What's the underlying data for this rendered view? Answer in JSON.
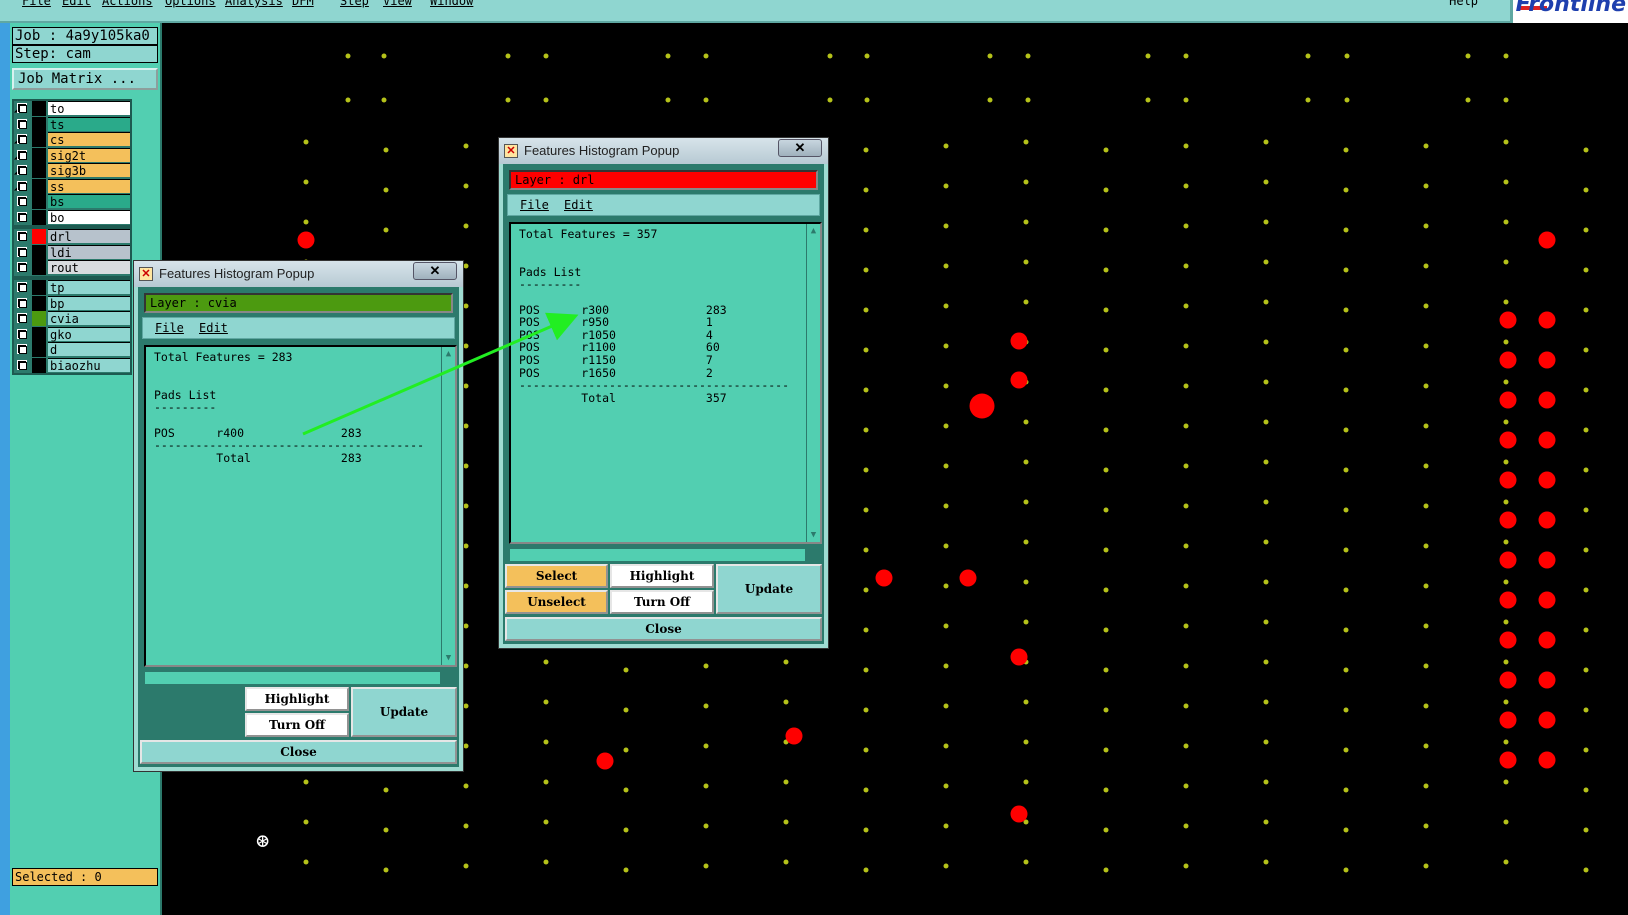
{
  "menubar": {
    "items": [
      "File",
      "Edit",
      "Actions",
      "Options",
      "Analysis",
      "DFM",
      "Step",
      "View",
      "Window"
    ],
    "help": "Help",
    "logo": "Frontline"
  },
  "job": {
    "job_label": "Job : 4a9y105ka0",
    "step_label": "Step: cam",
    "job_matrix_button": "Job Matrix ..."
  },
  "layers": {
    "group1": [
      {
        "name": "to",
        "color": "#ffffff",
        "swatch": "#000000",
        "arrow": true
      },
      {
        "name": "ts",
        "color": "#2aaa8a",
        "swatch": "#000000",
        "arrow": false
      },
      {
        "name": "cs",
        "color": "#f4c05b",
        "swatch": "#000000",
        "arrow": true
      },
      {
        "name": "sig2t",
        "color": "#f4c05b",
        "swatch": "#000000",
        "arrow": true
      },
      {
        "name": "sig3b",
        "color": "#f4c05b",
        "swatch": "#000000",
        "arrow": true
      },
      {
        "name": "ss",
        "color": "#f4c05b",
        "swatch": "#000000",
        "arrow": true
      },
      {
        "name": "bs",
        "color": "#2aaa8a",
        "swatch": "#000000",
        "arrow": false
      },
      {
        "name": "bo",
        "color": "#ffffff",
        "swatch": "#000000",
        "arrow": false
      }
    ],
    "group2": [
      {
        "name": "drl",
        "color": "#b7c2cc",
        "swatch": "#ff0000",
        "arrow": false
      },
      {
        "name": "ldi",
        "color": "#b7c2cc",
        "swatch": "#000000",
        "arrow": false
      },
      {
        "name": "rout",
        "color": "#d8dcdf",
        "swatch": "#000000",
        "arrow": false
      }
    ],
    "group3": [
      {
        "name": "tp",
        "color": "#8fd6d0",
        "swatch": "#000000",
        "arrow": false
      },
      {
        "name": "bp",
        "color": "#8fd6d0",
        "swatch": "#000000",
        "arrow": false
      },
      {
        "name": "cvia",
        "color": "#8fd6d0",
        "swatch": "#4c9a10",
        "arrow": false
      },
      {
        "name": "gko",
        "color": "#8fd6d0",
        "swatch": "#000000",
        "arrow": false
      },
      {
        "name": "d",
        "color": "#8fd6d0",
        "swatch": "#000000",
        "arrow": false
      },
      {
        "name": "biaozhu",
        "color": "#8fd6d0",
        "swatch": "#000000",
        "arrow": false
      }
    ]
  },
  "status": {
    "selected": "Selected : 0"
  },
  "popup_left": {
    "title": "Features Histogram Popup",
    "layer_label": "Layer :  cvia",
    "layer_color": "#4c9a10",
    "menu": {
      "file": "File",
      "edit": "Edit"
    },
    "content": "Total Features = 283\n\n\nPads List\n---------\n\nPOS      r400              283\n---------------------------------------\n         Total             283",
    "buttons": {
      "highlight": "Highlight",
      "turn_off": "Turn Off",
      "update": "Update",
      "close": "Close"
    }
  },
  "popup_right": {
    "title": "Features Histogram Popup",
    "layer_label": "Layer :  drl",
    "layer_color": "#ff0000",
    "menu": {
      "file": "File",
      "edit": "Edit"
    },
    "content": "Total Features = 357\n\n\nPads List\n---------\n\nPOS      r300              283\nPOS      r950              1\nPOS      r1050             4\nPOS      r1100             60\nPOS      r1150             7\nPOS      r1650             2\n---------------------------------------\n         Total             357",
    "buttons": {
      "select": "Select",
      "highlight": "Highlight",
      "unselect": "Unselect",
      "turn_off": "Turn Off",
      "update": "Update",
      "close": "Close"
    }
  },
  "colors": {
    "canvas_bg": "#000000",
    "via_pad": "#b5c21a",
    "drill_pad": "#ff0000",
    "annotation_arrow": "#22ee22"
  }
}
